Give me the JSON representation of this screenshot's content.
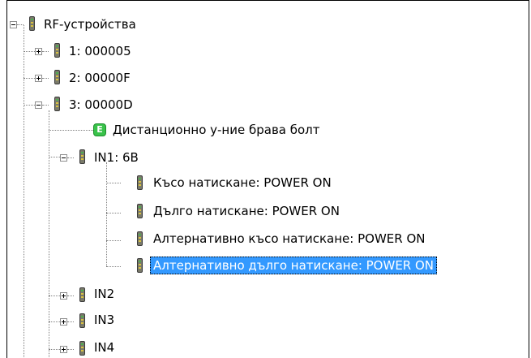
{
  "tree": {
    "root": "RF-устройства",
    "devices": [
      {
        "label": "1: 000005"
      },
      {
        "label": "2: 00000F"
      },
      {
        "label": "3: 00000D"
      }
    ],
    "device3_children": {
      "desc": "Дистанционно у-ние брава болт",
      "in1": "IN1: 6B",
      "in1_items": [
        "Късо натискане: POWER ON",
        "Дълго натискане: POWER ON",
        "Алтернативно късо натискане: POWER ON",
        "Алтернативно дълго натискане: POWER ON"
      ],
      "in2": "IN2",
      "in3": "IN3",
      "in4": "IN4"
    },
    "e_icon_glyph": "E"
  }
}
